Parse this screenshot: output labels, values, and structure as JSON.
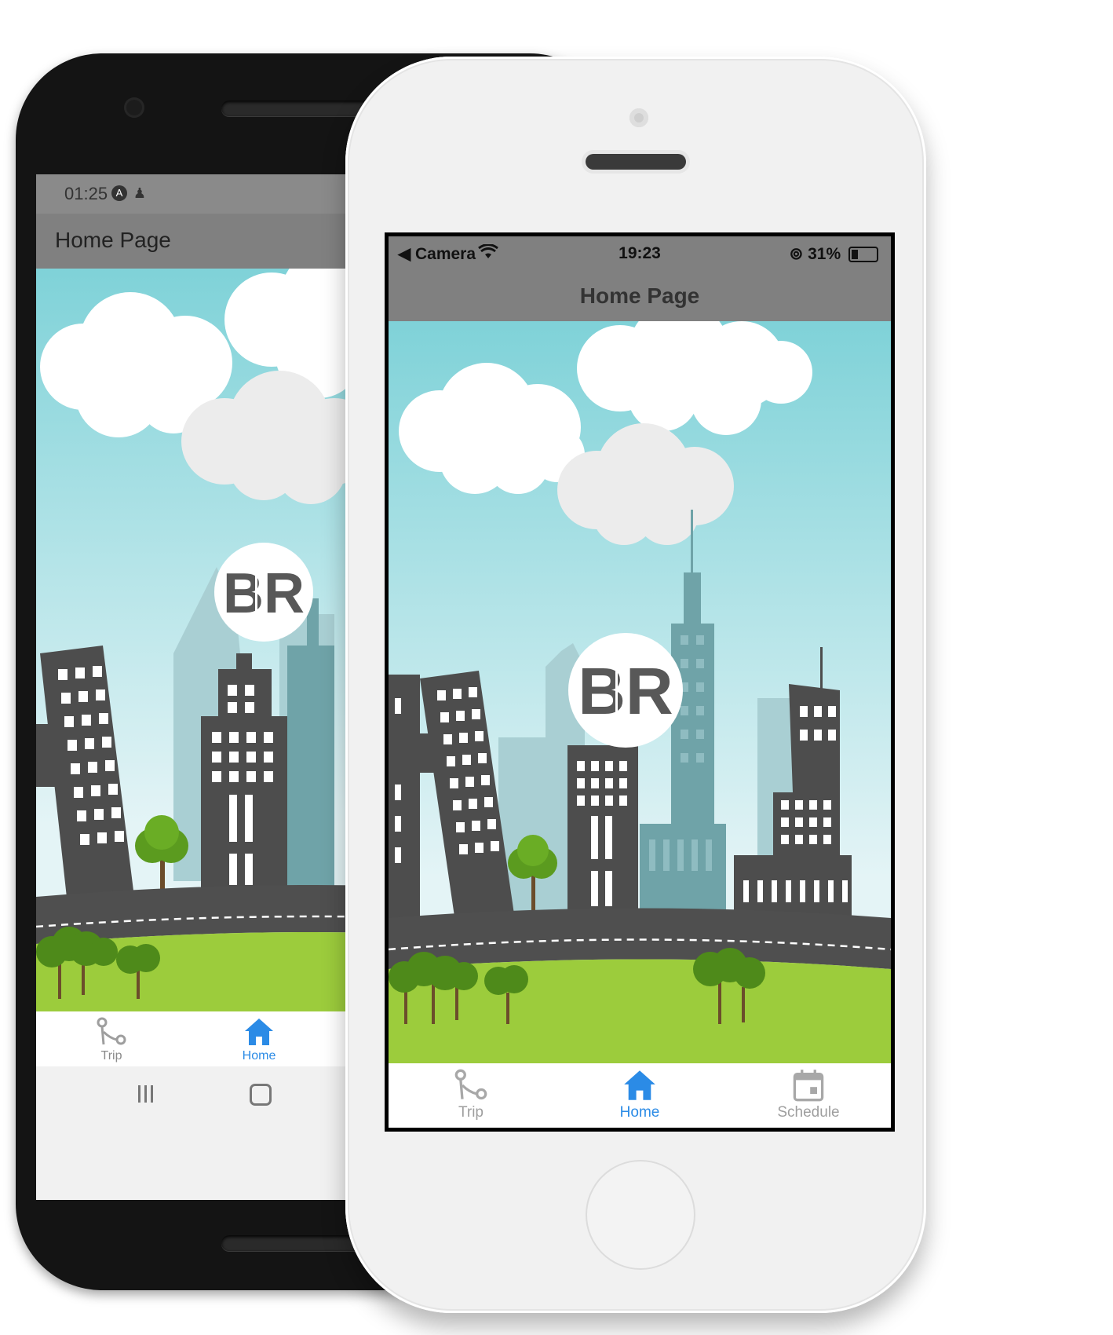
{
  "android": {
    "status_time": "01:25",
    "status_icons": [
      "app-a-icon",
      "notification-icon"
    ],
    "title": "Home Page",
    "tabs": [
      {
        "label": "Trip",
        "icon": "trip-route-icon",
        "color": "#9e9e9e"
      },
      {
        "label": "Home",
        "icon": "home-icon",
        "color": "#2b8be6",
        "active": true
      }
    ],
    "nav_buttons": [
      "recent-apps-button",
      "home-nav-button"
    ]
  },
  "iphone": {
    "status_back": "◀ Camera",
    "status_time": "19:23",
    "status_battery": "31%",
    "title": "Home Page",
    "tabs": [
      {
        "label": "Trip",
        "icon": "trip-route-icon",
        "color": "#9e9e9e"
      },
      {
        "label": "Home",
        "icon": "home-icon",
        "color": "#2b8be6",
        "active": true
      },
      {
        "label": "Schedule",
        "icon": "calendar-icon",
        "color": "#9e9e9e"
      }
    ]
  },
  "logo_text": "BR",
  "colors": {
    "sky_top": "#7fd2d8",
    "sky_bottom": "#e4f4f6",
    "building_dark": "#4d4d4d",
    "building_light": "#a9cfd3",
    "road": "#4f4f4f",
    "grass": "#9ccc3c",
    "tree": "#5b9b1f",
    "accent": "#2b8be6",
    "appbar": "#808080"
  }
}
